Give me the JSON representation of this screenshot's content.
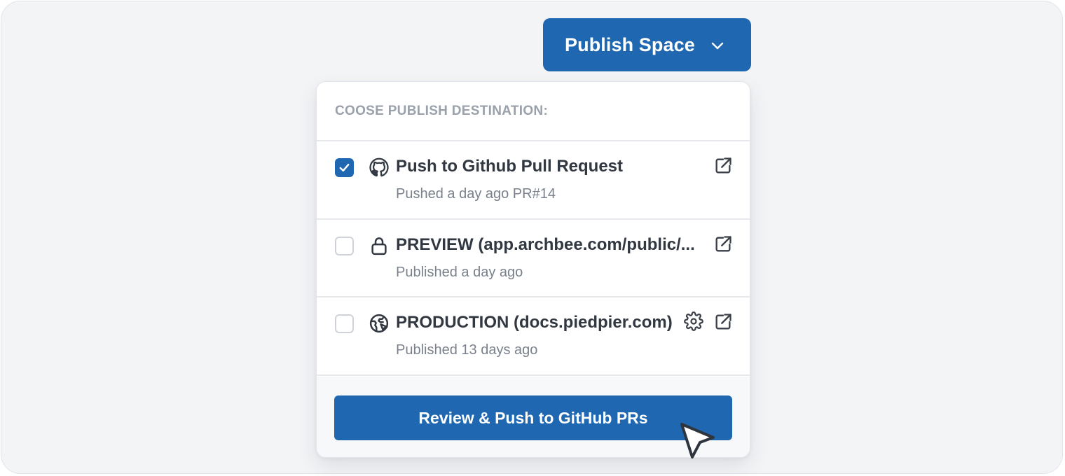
{
  "publish_button": {
    "label": "Publish Space",
    "icon": "chevron-down-icon"
  },
  "dropdown": {
    "header": "COOSE PUBLISH DESTINATION:",
    "options": [
      {
        "title": "Push to Github Pull Request",
        "subtitle": "Pushed a day ago PR#14",
        "checked": true,
        "icon": "github-icon"
      },
      {
        "title": "PREVIEW (app.archbee.com/public/...",
        "subtitle": "Published a day ago",
        "checked": false,
        "icon": "lock-icon"
      },
      {
        "title": "PRODUCTION (docs.piedpier.com)",
        "subtitle": "Published 13 days ago",
        "checked": false,
        "icon": "globe-icon"
      }
    ],
    "action_button": "Review & Push to GitHub PRs"
  },
  "colors": {
    "accent": "#1f67b1",
    "background": "#f3f4f6",
    "title_text": "#323841",
    "muted_text": "#7a818c",
    "header_text": "#9aa1ab"
  }
}
